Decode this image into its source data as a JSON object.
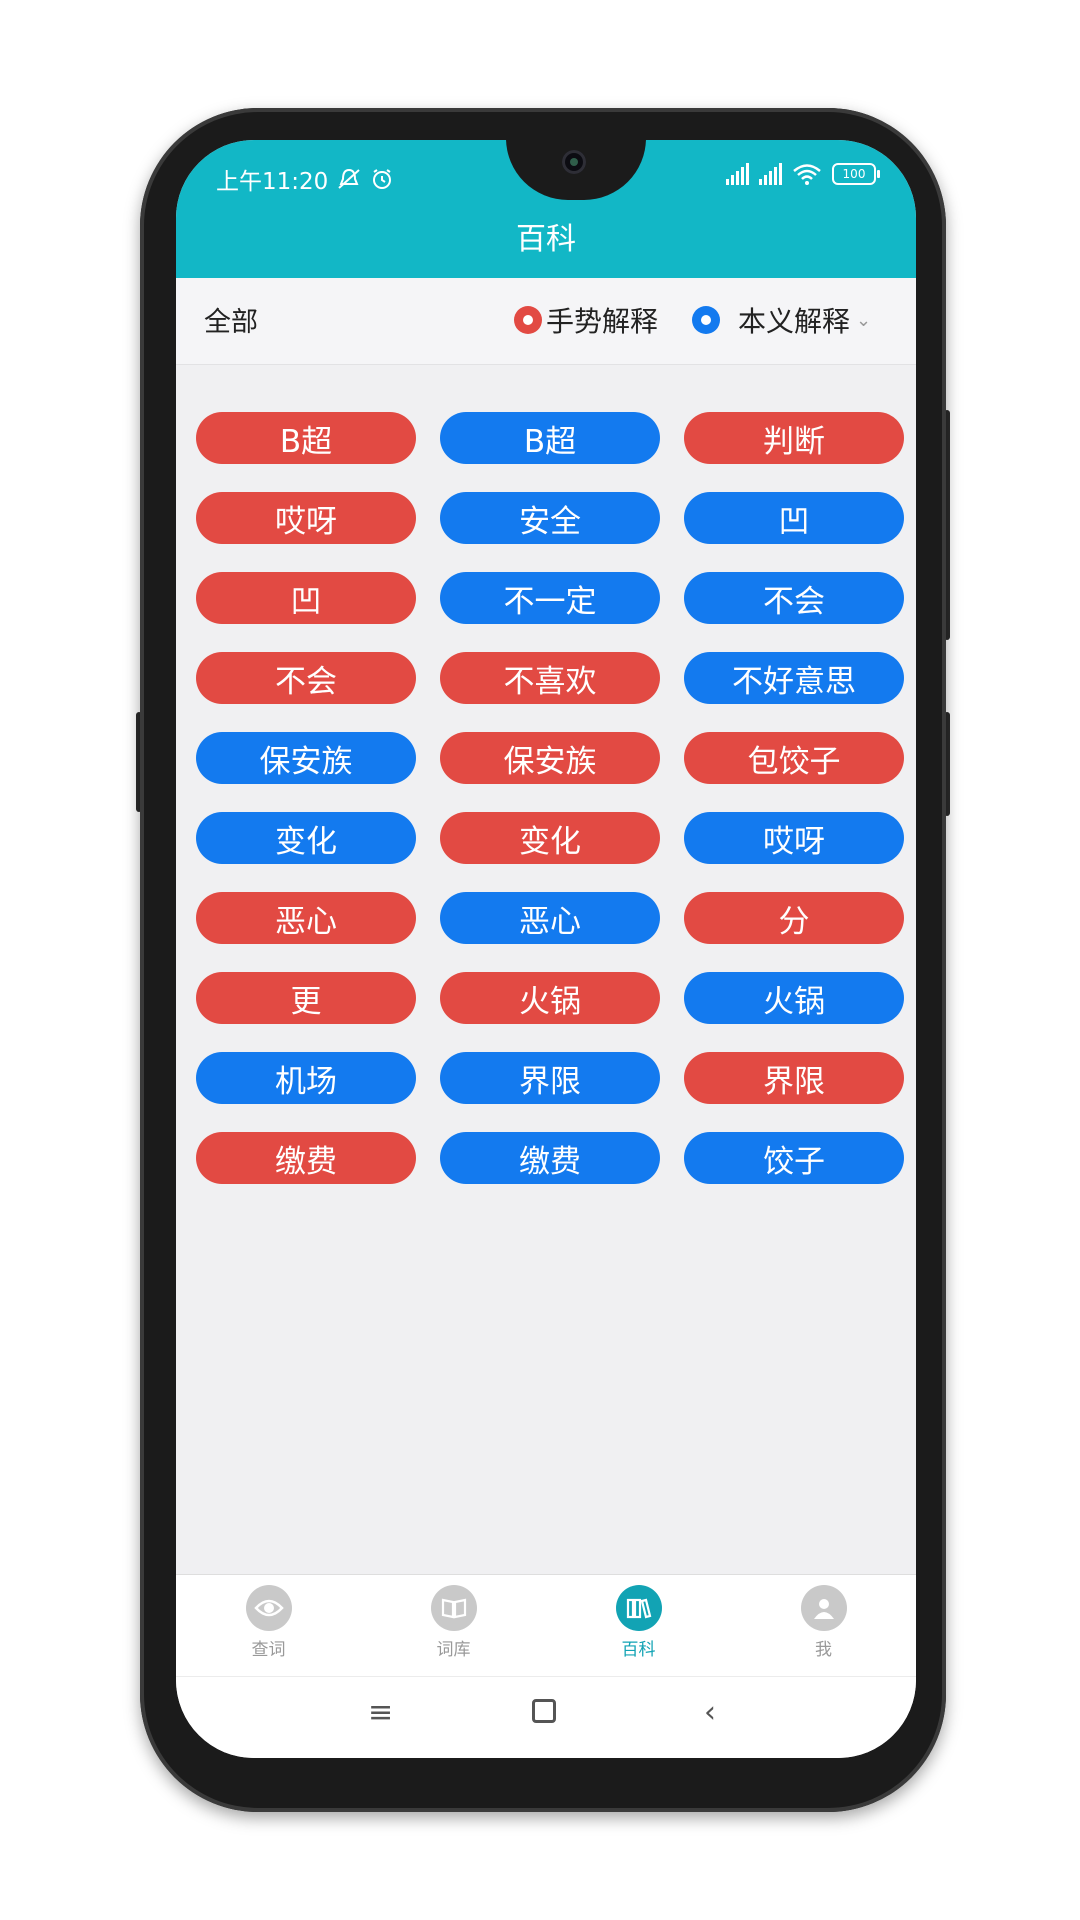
{
  "status_bar": {
    "time": "上午11:20",
    "battery": "100"
  },
  "header": {
    "title": "百科"
  },
  "filter": {
    "category": "全部",
    "legend_red": "手势解释",
    "legend_blue": "本义解释"
  },
  "colors": {
    "header": "#12b7c6",
    "red": "#e24a43",
    "blue": "#137aef",
    "active_tab": "#12a3b4"
  },
  "items": [
    {
      "label": "B超",
      "color": "red"
    },
    {
      "label": "B超",
      "color": "blue"
    },
    {
      "label": "判断",
      "color": "red"
    },
    {
      "label": "哎呀",
      "color": "red"
    },
    {
      "label": "安全",
      "color": "blue"
    },
    {
      "label": "凹",
      "color": "blue"
    },
    {
      "label": "凹",
      "color": "red"
    },
    {
      "label": "不一定",
      "color": "blue"
    },
    {
      "label": "不会",
      "color": "blue"
    },
    {
      "label": "不会",
      "color": "red"
    },
    {
      "label": "不喜欢",
      "color": "red"
    },
    {
      "label": "不好意思",
      "color": "blue"
    },
    {
      "label": "保安族",
      "color": "blue"
    },
    {
      "label": "保安族",
      "color": "red"
    },
    {
      "label": "包饺子",
      "color": "red"
    },
    {
      "label": "变化",
      "color": "blue"
    },
    {
      "label": "变化",
      "color": "red"
    },
    {
      "label": "哎呀",
      "color": "blue"
    },
    {
      "label": "恶心",
      "color": "red"
    },
    {
      "label": "恶心",
      "color": "blue"
    },
    {
      "label": "分",
      "color": "red"
    },
    {
      "label": "更",
      "color": "red"
    },
    {
      "label": "火锅",
      "color": "red"
    },
    {
      "label": "火锅",
      "color": "blue"
    },
    {
      "label": "机场",
      "color": "blue"
    },
    {
      "label": "界限",
      "color": "blue"
    },
    {
      "label": "界限",
      "color": "red"
    },
    {
      "label": "缴费",
      "color": "red"
    },
    {
      "label": "缴费",
      "color": "blue"
    },
    {
      "label": "饺子",
      "color": "blue"
    }
  ],
  "tabs": [
    {
      "label": "查词",
      "icon": "eye-icon",
      "active": false
    },
    {
      "label": "词库",
      "icon": "book-icon",
      "active": false
    },
    {
      "label": "百科",
      "icon": "books-icon",
      "active": true
    },
    {
      "label": "我",
      "icon": "user-icon",
      "active": false
    }
  ],
  "nav": {
    "menu": "≡",
    "back": "‹"
  }
}
